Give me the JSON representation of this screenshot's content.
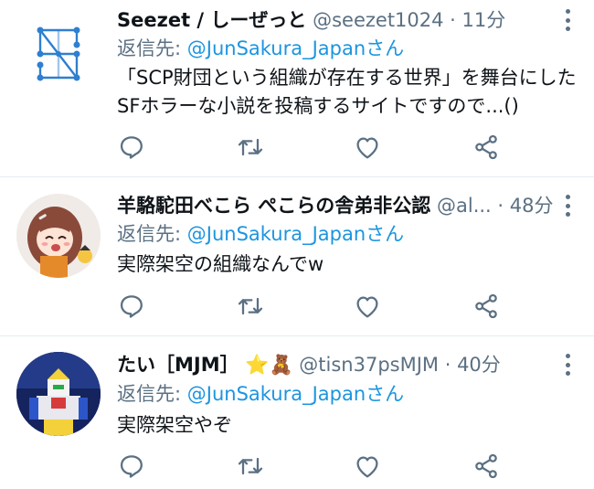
{
  "tweets": [
    {
      "name": "Seezet / しーぜっと",
      "handle": "@seezet1024",
      "dot": " · ",
      "time": "11分",
      "reply_label": "返信先: ",
      "reply_user": "@JunSakura_Japanさん",
      "lines": [
        "「SCP財団という組織が存在する世界」を舞台にした",
        "SFホラーな小説を投稿するサイトですので...()"
      ],
      "avatar_icon": "scp-logo-icon"
    },
    {
      "name": "羊駱駝田べこら ぺこらの舎弟非公認",
      "handle": "@al...",
      "dot": " · ",
      "time": "48分",
      "reply_label": "返信先: ",
      "reply_user": "@JunSakura_Japanさん",
      "lines": [
        "実際架空の組織なんでw"
      ],
      "avatar_icon": "anime-girl-avatar"
    },
    {
      "name": "たい［MJM］",
      "emoji": "⭐🧸",
      "handle": "@tisn37psMJM",
      "dot": " · ",
      "time": "40分",
      "reply_label": "返信先: ",
      "reply_user": "@JunSakura_Japanさん",
      "lines": [
        "実際架空やぞ"
      ],
      "avatar_icon": "robot-avatar"
    }
  ],
  "colors": {
    "secondary": "#5b7083",
    "link": "#1b95e0",
    "divider": "#e6ecf0",
    "text": "#0f1419"
  }
}
